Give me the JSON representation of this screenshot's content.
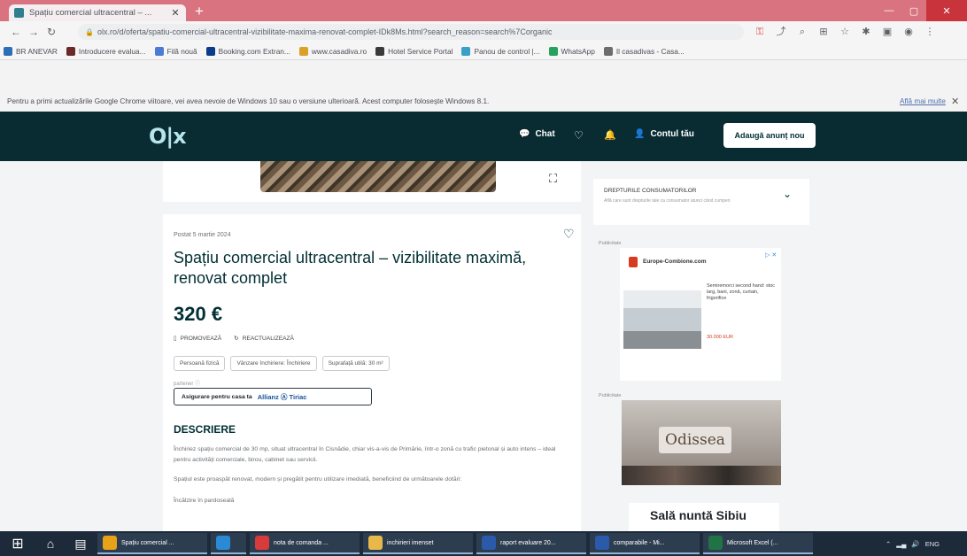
{
  "browser": {
    "tab_title": "Spațiu comercial ultracentral – ...",
    "url": "olx.ro/d/oferta/spatiu-comercial-ultracentral-vizibilitate-maxima-renovat-complet-IDk8Ms.html?search_reason=search%7Corganic",
    "bookmarks": [
      {
        "label": "BR ANEVAR",
        "color": "#2b6fb6"
      },
      {
        "label": "Introducere evalua...",
        "color": "#6a2a2a"
      },
      {
        "label": "Filă nouă",
        "color": "#4b7bd6"
      },
      {
        "label": "Booking.com Extran...",
        "color": "#0b3c8c"
      },
      {
        "label": "www.casadiva.ro",
        "color": "#d9a12a"
      },
      {
        "label": "Hotel Service Portal",
        "color": "#3a3a3a"
      },
      {
        "label": "Panou de control |...",
        "color": "#3aa0c8"
      },
      {
        "label": "WhatsApp",
        "color": "#25a35c"
      },
      {
        "label": "Il casadivas - Casa...",
        "color": "#6d6d6d"
      }
    ],
    "info_message": "Pentru a primi actualizările Google Chrome viitoare, vei avea nevoie de Windows 10 sau o versiune ulterioară. Acest computer folosește Windows 8.1.",
    "info_link": "Află mai multe"
  },
  "olx": {
    "logo": "olx",
    "nav": {
      "chat": "Chat",
      "account": "Contul tău",
      "post_button": "Adaugă anunț nou"
    }
  },
  "listing": {
    "posted": "Postat 5 martie 2024",
    "title": "Spațiu comercial ultracentral – vizibilitate maximă, renovat complet",
    "price": "320 €",
    "promote": "PROMOVEAZĂ",
    "refresh": "REACTUALIZEAZĂ",
    "tags": [
      "Persoană fizică",
      "Vânzare închiriere: Închiriere",
      "Suprafață utilă: 30 m²"
    ],
    "partner_label": "partener ⓘ",
    "insurance_text": "Asigurare pentru casa ta",
    "insurance_brand": "Allianz Ⓐ Tiriac",
    "description_heading": "DESCRIERE",
    "description": [
      "Închiriez spațiu comercial de 30 mp, situat ultracentral în Cisnădie, chiar vis-a-vis de Primărie, într-o zonă cu trafic pietonal și auto intens – ideal pentru activități comerciale, birou, cabinet sau servicii.",
      "Spațiul este proaspăt renovat, modern și pregătit pentru utilizare imediată, beneficiind de următoarele dotări:",
      "Încălzire în pardoseală"
    ]
  },
  "sidebar": {
    "consumer_heading": "DREPTURILE CONSUMATORILOR",
    "consumer_text": "Află care sunt drepturile tale ca consumator atunci când cumperi",
    "ad_label": "Publicitate",
    "ad1_brand": "Europe-Combione.com",
    "ad1_text": "Semiremorci second hand: stoc larg, bani, zonă, curtain, frigorifice",
    "ad1_price": "30.000 EUR",
    "ad2_sign": "Odissea",
    "ad3_title": "Sală nuntă Sibiu"
  },
  "taskbar": {
    "tasks": [
      {
        "label": "Spațiu comercial ...",
        "color": "#e7a21a"
      },
      {
        "label": "",
        "color": "#2b8ad6"
      },
      {
        "label": "nota de comanda ...",
        "color": "#d83b3b"
      },
      {
        "label": "inchirieri imenset",
        "color": "#e8b94a"
      },
      {
        "label": "raport evaluare 20...",
        "color": "#2b5aaa"
      },
      {
        "label": "comparabile - Mi...",
        "color": "#2b5aaa"
      },
      {
        "label": "Microsoft Excel (...",
        "color": "#217346"
      }
    ],
    "lang": "ENG"
  }
}
